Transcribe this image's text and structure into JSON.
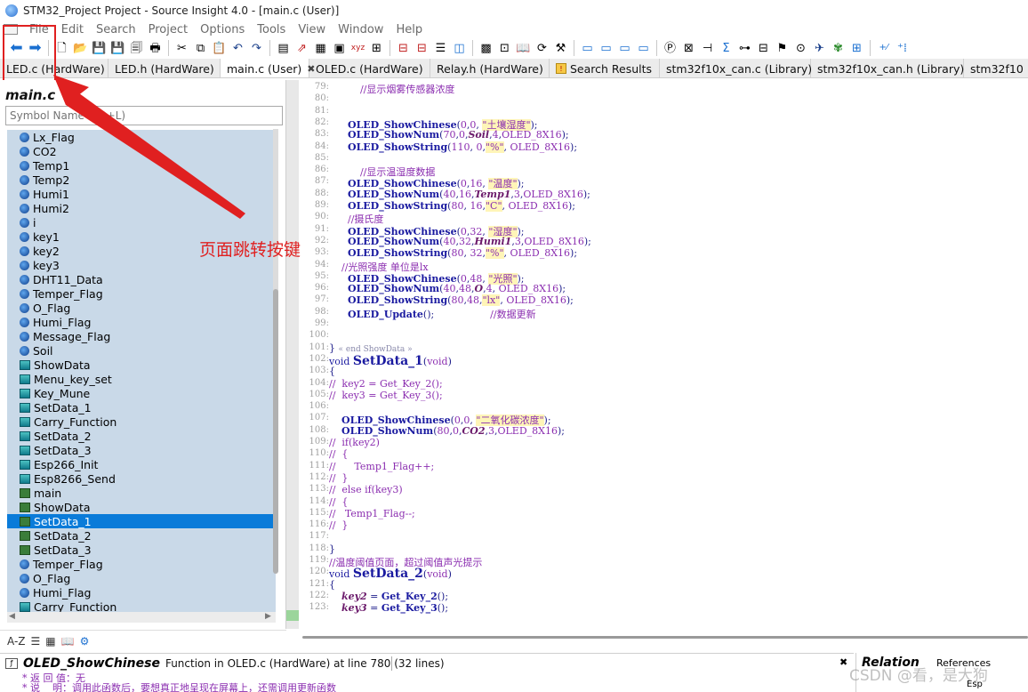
{
  "window": {
    "title": "STM32_Project Project - Source Insight 4.0 - [main.c (User)]"
  },
  "menu": [
    "File",
    "Edit",
    "Search",
    "Project",
    "Options",
    "Tools",
    "View",
    "Window",
    "Help"
  ],
  "tabs": [
    {
      "label": "LED.c (HardWare)",
      "width": 122
    },
    {
      "label": "LED.h (HardWare)",
      "width": 126
    },
    {
      "label": "main.c (User)",
      "width": 100,
      "active": true,
      "closable": true
    },
    {
      "label": "OLED.c (HardWare)",
      "width": 136
    },
    {
      "label": "Relay.h (HardWare)",
      "width": 134
    },
    {
      "label": "Search Results",
      "width": 124,
      "icon": true
    },
    {
      "label": "stm32f10x_can.c (Library)",
      "width": 170
    },
    {
      "label": "stm32f10x_can.h (Library)",
      "width": 172
    },
    {
      "label": "stm32f10",
      "width": 80
    }
  ],
  "symbol_panel": {
    "title": "main.c",
    "search_placeholder": "Symbol Name (Alt+L)",
    "items": [
      {
        "label": "Lx_Flag",
        "kind": "var"
      },
      {
        "label": "CO2",
        "kind": "var"
      },
      {
        "label": "Temp1",
        "kind": "var"
      },
      {
        "label": "Temp2",
        "kind": "var"
      },
      {
        "label": "Humi1",
        "kind": "var"
      },
      {
        "label": "Humi2",
        "kind": "var"
      },
      {
        "label": "i",
        "kind": "var"
      },
      {
        "label": "key1",
        "kind": "var"
      },
      {
        "label": "key2",
        "kind": "var"
      },
      {
        "label": "key3",
        "kind": "var"
      },
      {
        "label": "DHT11_Data",
        "kind": "var"
      },
      {
        "label": "Temper_Flag",
        "kind": "var"
      },
      {
        "label": "O_Flag",
        "kind": "var"
      },
      {
        "label": "Humi_Flag",
        "kind": "var"
      },
      {
        "label": "Message_Flag",
        "kind": "var"
      },
      {
        "label": "Soil",
        "kind": "var"
      },
      {
        "label": "ShowData",
        "kind": "func"
      },
      {
        "label": "Menu_key_set",
        "kind": "func"
      },
      {
        "label": "Key_Mune",
        "kind": "func"
      },
      {
        "label": "SetData_1",
        "kind": "func"
      },
      {
        "label": "Carry_Function",
        "kind": "func"
      },
      {
        "label": "SetData_2",
        "kind": "func"
      },
      {
        "label": "SetData_3",
        "kind": "func"
      },
      {
        "label": "Esp266_Init",
        "kind": "func"
      },
      {
        "label": "Esp8266_Send",
        "kind": "func"
      },
      {
        "label": "main",
        "kind": "def"
      },
      {
        "label": "ShowData",
        "kind": "def"
      },
      {
        "label": "SetData_1",
        "kind": "def",
        "selected": true
      },
      {
        "label": "SetData_2",
        "kind": "def"
      },
      {
        "label": "SetData_3",
        "kind": "def"
      },
      {
        "label": "Temper_Flag",
        "kind": "var"
      },
      {
        "label": "O_Flag",
        "kind": "var"
      },
      {
        "label": "Humi_Flag",
        "kind": "var"
      },
      {
        "label": "Carry_Function",
        "kind": "func"
      }
    ]
  },
  "code_lines": [
    {
      "n": "79:",
      "html": "          <span class='c-cm'>//显示烟雾传感器浓度</span>"
    },
    {
      "n": "80:",
      "html": ""
    },
    {
      "n": "81:",
      "html": ""
    },
    {
      "n": "82:",
      "html": "      <span class='c-fn'>OLED_ShowChinese</span>(<span class='c-const'>0</span>,<span class='c-const'>0</span>, <span class='c-str'>\"土壤湿度\"</span>);"
    },
    {
      "n": "83:",
      "html": "      <span class='c-fn'>OLED_ShowNum</span>(<span class='c-const'>70</span>,<span class='c-const'>0</span>,<span class='c-var'>Soil</span>,<span class='c-const'>4</span>,<span class='c-const'>OLED_8X16</span>);"
    },
    {
      "n": "84:",
      "html": "      <span class='c-fn'>OLED_ShowString</span>(<span class='c-const'>110</span>, <span class='c-const'>0</span>,<span class='c-str'>\"%\"</span>, <span class='c-const'>OLED_8X16</span>);"
    },
    {
      "n": "85:",
      "html": ""
    },
    {
      "n": "86:",
      "html": "          <span class='c-cm'>//显示温湿度数据</span>"
    },
    {
      "n": "87:",
      "html": "      <span class='c-fn'>OLED_ShowChinese</span>(<span class='c-const'>0</span>,<span class='c-const'>16</span>, <span class='c-str'>\"温度\"</span>);"
    },
    {
      "n": "88:",
      "html": "      <span class='c-fn'>OLED_ShowNum</span>(<span class='c-const'>40</span>,<span class='c-const'>16</span>,<span class='c-var'>Temp1</span>,<span class='c-const'>3</span>,<span class='c-const'>OLED_8X16</span>);"
    },
    {
      "n": "89:",
      "html": "      <span class='c-fn'>OLED_ShowString</span>(<span class='c-const'>80</span>, <span class='c-const'>16</span>,<span class='c-str'>\"C\"</span>, <span class='c-const'>OLED_8X16</span>);"
    },
    {
      "n": "90:",
      "html": "      <span class='c-cm'>//摄氏度</span>"
    },
    {
      "n": "91:",
      "html": "      <span class='c-fn'>OLED_ShowChinese</span>(<span class='c-const'>0</span>,<span class='c-const'>32</span>, <span class='c-str'>\"湿度\"</span>);"
    },
    {
      "n": "92:",
      "html": "      <span class='c-fn'>OLED_ShowNum</span>(<span class='c-const'>40</span>,<span class='c-const'>32</span>,<span class='c-var'>Humi1</span>,<span class='c-const'>3</span>,<span class='c-const'>OLED_8X16</span>);"
    },
    {
      "n": "93:",
      "html": "      <span class='c-fn'>OLED_ShowString</span>(<span class='c-const'>80</span>, <span class='c-const'>32</span>,<span class='c-str'>\"%\"</span>, <span class='c-const'>OLED_8X16</span>);"
    },
    {
      "n": "94:",
      "html": "    <span class='c-cm'>//光照强度 单位是lx</span>"
    },
    {
      "n": "95:",
      "html": "      <span class='c-fn'>OLED_ShowChinese</span>(<span class='c-const'>0</span>,<span class='c-const'>48</span>, <span class='c-str'>\"光照\"</span>);"
    },
    {
      "n": "96:",
      "html": "      <span class='c-fn'>OLED_ShowNum</span>(<span class='c-const'>40</span>,<span class='c-const'>48</span>,<span class='c-var'>O</span>,<span class='c-const'>4</span>, <span class='c-const'>OLED_8X16</span>);"
    },
    {
      "n": "97:",
      "html": "      <span class='c-fn'>OLED_ShowString</span>(<span class='c-const'>80</span>,<span class='c-const'>48</span>,<span class='c-str'>\"lx\"</span>, <span class='c-const'>OLED_8X16</span>);"
    },
    {
      "n": "98:",
      "html": "      <span class='c-fn'>OLED_Update</span>();                  <span class='c-cm'>//数据更新</span>"
    },
    {
      "n": "99:",
      "html": ""
    },
    {
      "n": "100:",
      "html": ""
    },
    {
      "n": "101:",
      "html": "} <span class='c-small'>« end ShowData »</span>"
    },
    {
      "n": "102:",
      "html": "<span class='c-kw'>void</span> <span class='c-big'>SetData_1</span>(<span class='c-const'>void</span>)"
    },
    {
      "n": "103:",
      "html": "{"
    },
    {
      "n": "104:",
      "html": "<span class='c-cm'>//  key2 = Get_Key_2();</span>"
    },
    {
      "n": "105:",
      "html": "<span class='c-cm'>//  key3 = Get_Key_3();</span>"
    },
    {
      "n": "106:",
      "html": ""
    },
    {
      "n": "107:",
      "html": "    <span class='c-fn'>OLED_ShowChinese</span>(<span class='c-const'>0</span>,<span class='c-const'>0</span>, <span class='c-str'>\"二氧化碳浓度\"</span>);"
    },
    {
      "n": "108:",
      "html": "    <span class='c-fn'>OLED_ShowNum</span>(<span class='c-const'>80</span>,<span class='c-const'>0</span>,<span class='c-var'>CO2</span>,<span class='c-const'>3</span>,<span class='c-const'>OLED_8X16</span>);"
    },
    {
      "n": "109:",
      "html": "<span class='c-cm'>//  if(key2)</span>"
    },
    {
      "n": "110:",
      "html": "<span class='c-cm'>//  {</span>"
    },
    {
      "n": "111:",
      "html": "<span class='c-cm'>//      Temp1_Flag++;</span>"
    },
    {
      "n": "112:",
      "html": "<span class='c-cm'>//  }</span>"
    },
    {
      "n": "113:",
      "html": "<span class='c-cm'>//  else if(key3)</span>"
    },
    {
      "n": "114:",
      "html": "<span class='c-cm'>//  {</span>"
    },
    {
      "n": "115:",
      "html": "<span class='c-cm'>//   Temp1_Flag--;</span>"
    },
    {
      "n": "116:",
      "html": "<span class='c-cm'>//  }</span>"
    },
    {
      "n": "117:",
      "html": ""
    },
    {
      "n": "118:",
      "html": "}"
    },
    {
      "n": "119:",
      "html": "<span class='c-cm'>//温度阈值页面，超过阈值声光提示</span>"
    },
    {
      "n": "120:",
      "html": "<span class='c-kw'>void</span> <span class='c-big'>SetData_2</span>(<span class='c-const'>void</span>)"
    },
    {
      "n": "121:",
      "html": "{"
    },
    {
      "n": "122:",
      "html": "    <span class='c-var'>key2</span> = <span class='c-fn'>Get_Key_2</span>();"
    },
    {
      "n": "123:",
      "html": "    <span class='c-var'>key3</span> = <span class='c-fn'>Get_Key_3</span>();"
    }
  ],
  "info": {
    "name": "OLED_ShowChinese",
    "desc": "Function in OLED.c (HardWare) at line 780 (32 lines)",
    "text_line1": "  * 返 回 值：无",
    "text_line2": "  * 说    明：调用此函数后，要想真正地呈现在屏幕上，还需调用更新函数"
  },
  "relation": {
    "title": "Relation",
    "sub": "References",
    "item": "Esp"
  },
  "annotation": {
    "label": "页面跳转按键"
  },
  "watermark": "CSDN @看，是大狗"
}
